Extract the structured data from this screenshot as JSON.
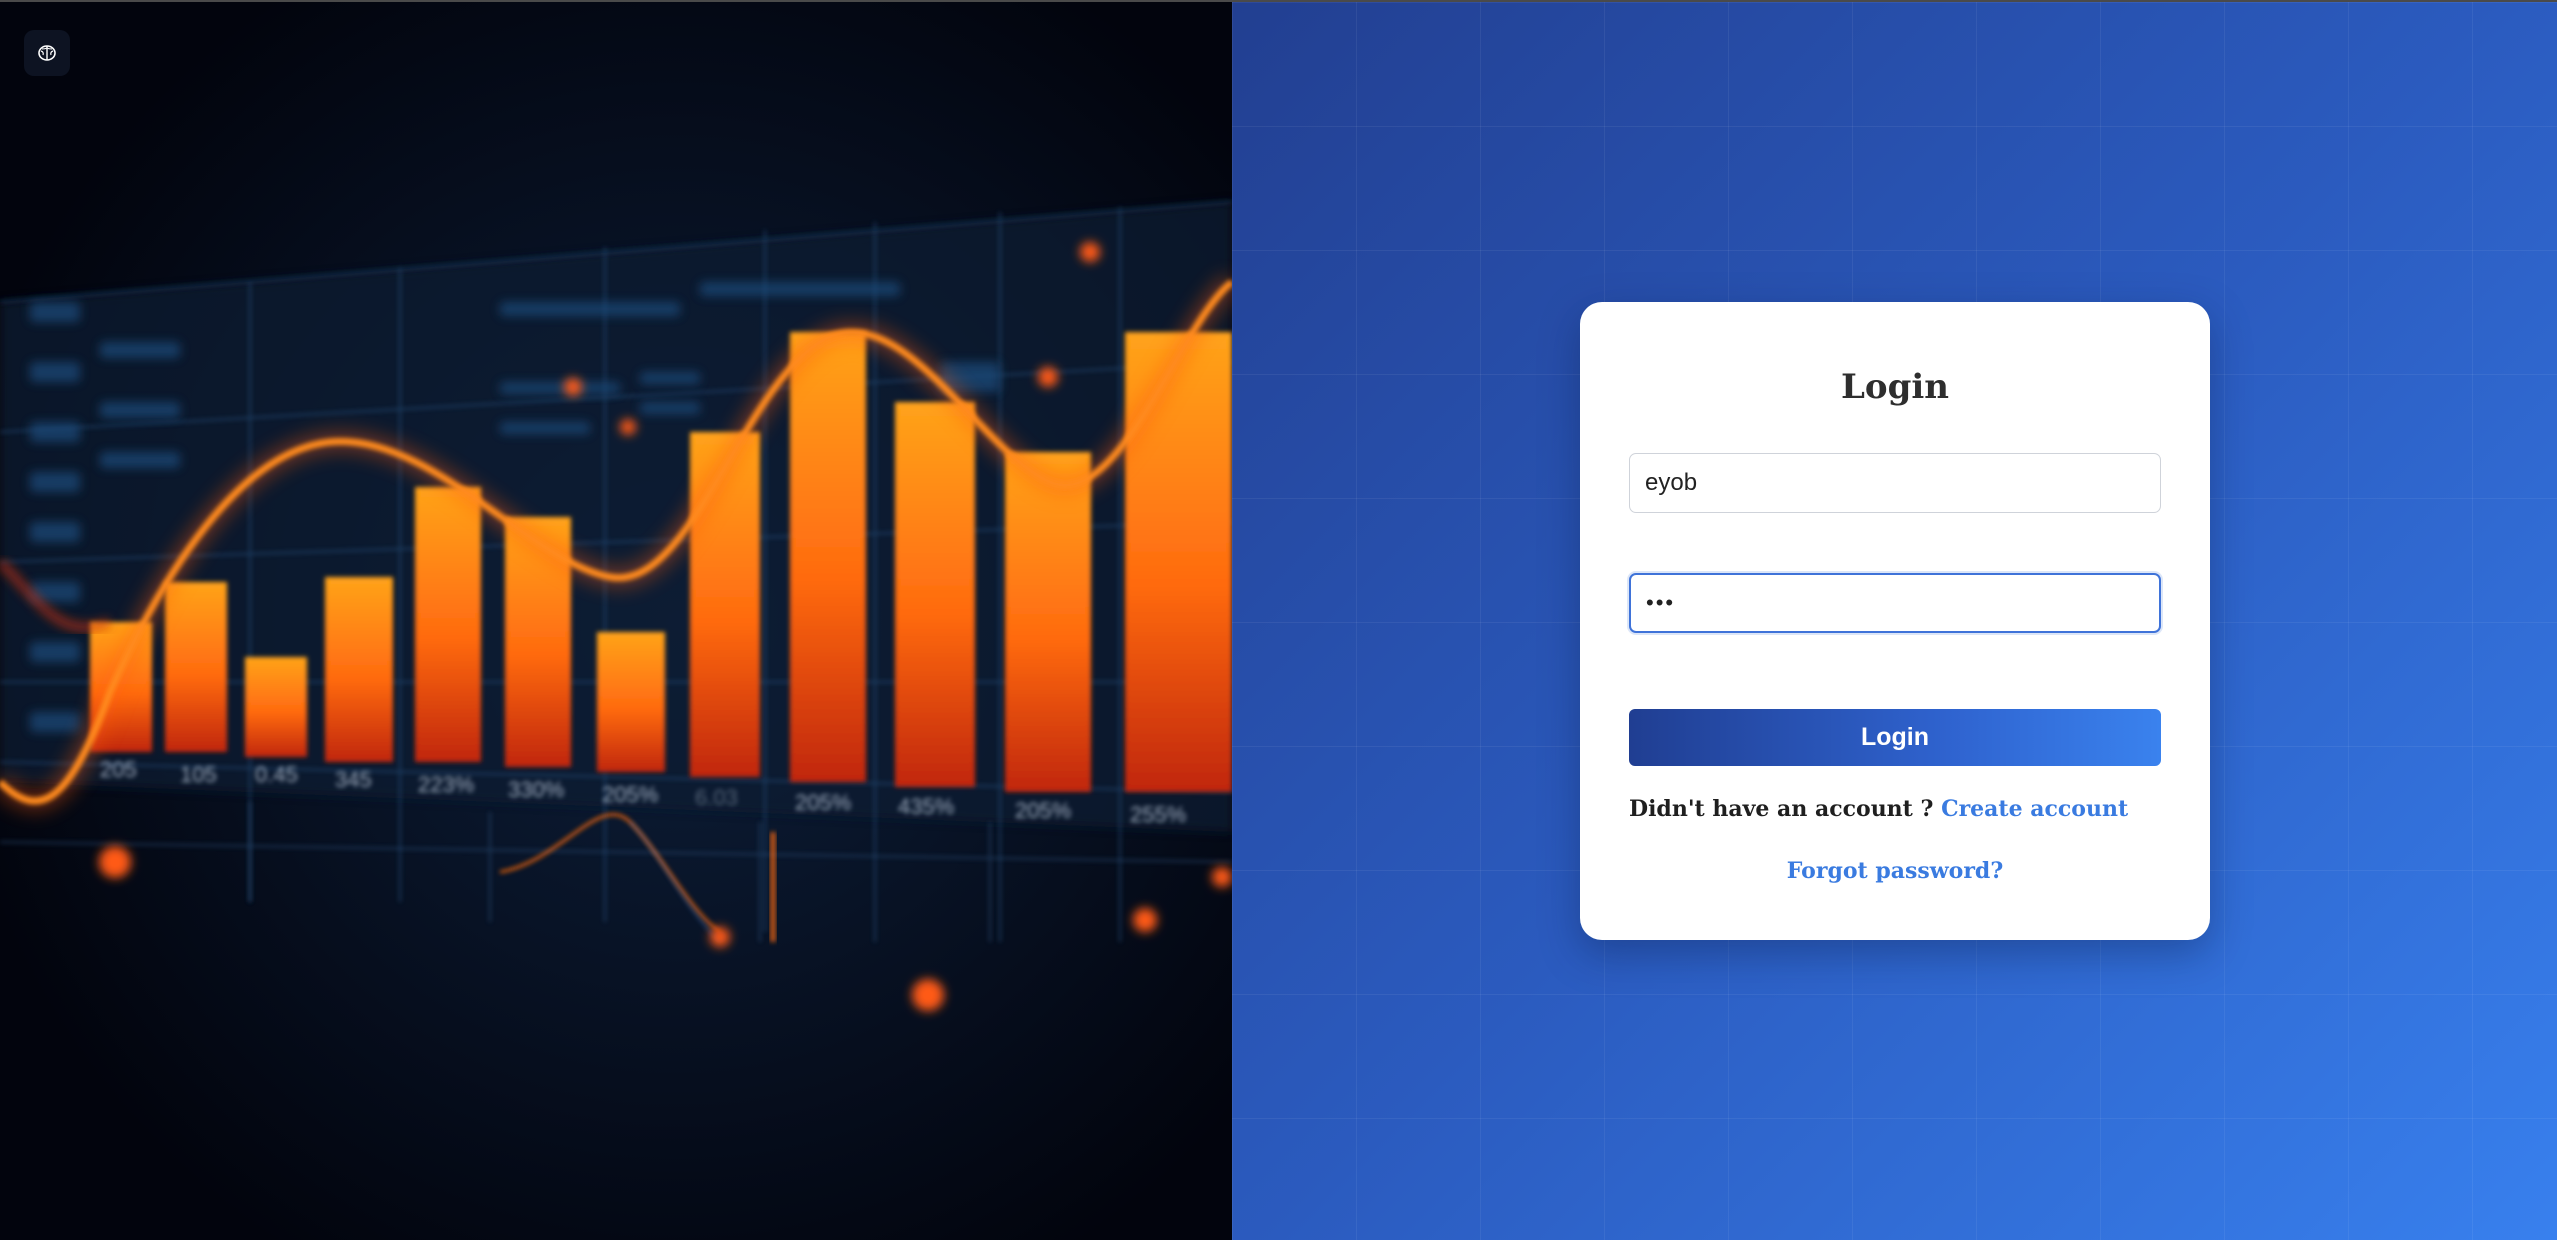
{
  "hero": {
    "logo_icon": "brain-icon",
    "image_description_icon": "analytics-chart-illustration",
    "chart_tick_labels": [
      "205",
      "105",
      "0.45",
      "345",
      "223%",
      "330%",
      "205%",
      "6.03",
      "205%",
      "435%",
      "205%",
      "255%"
    ]
  },
  "login": {
    "title": "Login",
    "username_value": "eyob",
    "username_placeholder": "",
    "password_value": "•••",
    "submit_label": "Login",
    "signup_prompt": "Didn't have an account ?",
    "signup_link": "Create account",
    "forgot_link": "Forgot password?"
  },
  "colors": {
    "accent": "#3a7be0",
    "button_start": "#203e92",
    "button_end": "#3a82ee",
    "hero_bar": "#ff6a10",
    "hero_bg": "#02040d"
  }
}
